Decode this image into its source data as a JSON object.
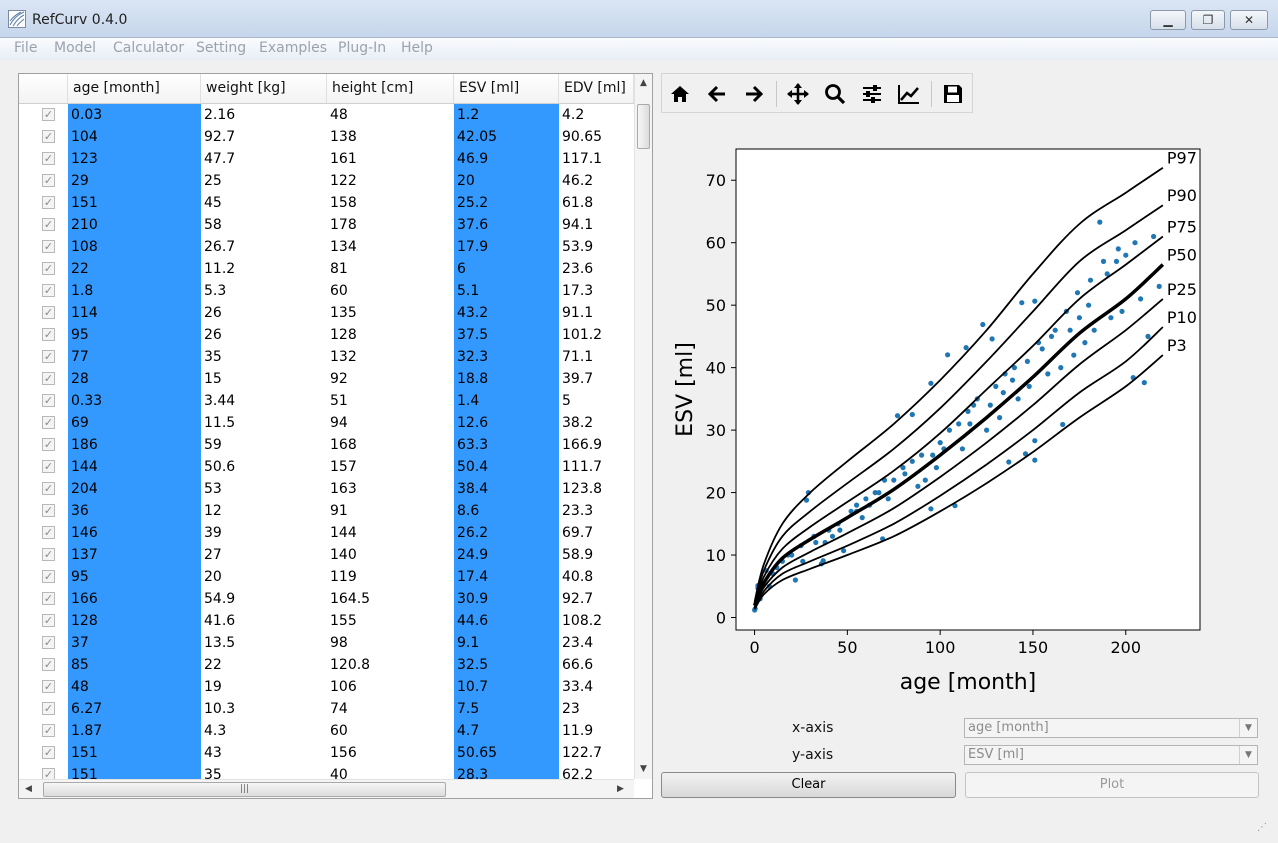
{
  "window": {
    "title": "RefCurv 0.4.0",
    "minimize": "▁",
    "maximize": "❐",
    "close": "✕"
  },
  "menu": [
    "File",
    "Model",
    "Calculator",
    "Setting",
    "Examples",
    "Plug-In",
    "Help"
  ],
  "table": {
    "columns": [
      "age [month]",
      "weight [kg]",
      "height [cm]",
      "ESV [ml]",
      "EDV [ml]"
    ],
    "rows": [
      [
        "0.03",
        "2.16",
        "48",
        "1.2",
        "4.2"
      ],
      [
        "104",
        "92.7",
        "138",
        "42.05",
        "90.65"
      ],
      [
        "123",
        "47.7",
        "161",
        "46.9",
        "117.1"
      ],
      [
        "29",
        "25",
        "122",
        "20",
        "46.2"
      ],
      [
        "151",
        "45",
        "158",
        "25.2",
        "61.8"
      ],
      [
        "210",
        "58",
        "178",
        "37.6",
        "94.1"
      ],
      [
        "108",
        "26.7",
        "134",
        "17.9",
        "53.9"
      ],
      [
        "22",
        "11.2",
        "81",
        "6",
        "23.6"
      ],
      [
        "1.8",
        "5.3",
        "60",
        "5.1",
        "17.3"
      ],
      [
        "114",
        "26",
        "135",
        "43.2",
        "91.1"
      ],
      [
        "95",
        "26",
        "128",
        "37.5",
        "101.2"
      ],
      [
        "77",
        "35",
        "132",
        "32.3",
        "71.1"
      ],
      [
        "28",
        "15",
        "92",
        "18.8",
        "39.7"
      ],
      [
        "0.33",
        "3.44",
        "51",
        "1.4",
        "5"
      ],
      [
        "69",
        "11.5",
        "94",
        "12.6",
        "38.2"
      ],
      [
        "186",
        "59",
        "168",
        "63.3",
        "166.9"
      ],
      [
        "144",
        "50.6",
        "157",
        "50.4",
        "111.7"
      ],
      [
        "204",
        "53",
        "163",
        "38.4",
        "123.8"
      ],
      [
        "36",
        "12",
        "91",
        "8.6",
        "23.3"
      ],
      [
        "146",
        "39",
        "144",
        "26.2",
        "69.7"
      ],
      [
        "137",
        "27",
        "140",
        "24.9",
        "58.9"
      ],
      [
        "95",
        "20",
        "119",
        "17.4",
        "40.8"
      ],
      [
        "166",
        "54.9",
        "164.5",
        "30.9",
        "92.7"
      ],
      [
        "128",
        "41.6",
        "155",
        "44.6",
        "108.2"
      ],
      [
        "37",
        "13.5",
        "98",
        "9.1",
        "23.4"
      ],
      [
        "85",
        "22",
        "120.8",
        "32.5",
        "66.6"
      ],
      [
        "48",
        "19",
        "106",
        "10.7",
        "33.4"
      ],
      [
        "6.27",
        "10.3",
        "74",
        "7.5",
        "23"
      ],
      [
        "1.87",
        "4.3",
        "60",
        "4.7",
        "11.9"
      ],
      [
        "151",
        "43",
        "156",
        "50.65",
        "122.7"
      ],
      [
        "151",
        "35",
        "40",
        "28.3",
        "62.2"
      ]
    ],
    "check_mark": "✓",
    "selected_columns": [
      0,
      3
    ],
    "hscroll_grip": "|||"
  },
  "toolbar": {
    "icons": [
      "home-icon",
      "back-arrow-icon",
      "forward-arrow-icon",
      "pan-icon",
      "zoom-icon",
      "configure-subplots-icon",
      "edit-axis-icon",
      "save-icon"
    ]
  },
  "chart_data": {
    "type": "line",
    "xlabel": "age [month]",
    "ylabel": "ESV [ml]",
    "xlim": [
      -10,
      240
    ],
    "ylim": [
      -2,
      75
    ],
    "xticks": [
      0,
      50,
      100,
      150,
      200
    ],
    "yticks": [
      0,
      10,
      20,
      30,
      40,
      50,
      60,
      70
    ],
    "grid": false,
    "series": [
      {
        "name": "P97",
        "x": [
          0,
          5,
          15,
          30,
          50,
          75,
          100,
          125,
          150,
          175,
          200,
          220
        ],
        "y": [
          2.5,
          8.5,
          15,
          20,
          25,
          31,
          38,
          46,
          55,
          63,
          68,
          72
        ]
      },
      {
        "name": "P90",
        "x": [
          0,
          5,
          15,
          30,
          50,
          75,
          100,
          125,
          150,
          175,
          200,
          220
        ],
        "y": [
          2.3,
          7.5,
          13,
          17,
          21.5,
          27,
          33.5,
          41,
          49,
          57,
          62,
          66
        ]
      },
      {
        "name": "P75",
        "x": [
          0,
          5,
          15,
          30,
          50,
          75,
          100,
          125,
          150,
          175,
          200,
          220
        ],
        "y": [
          2.1,
          6.5,
          11,
          14.5,
          18.5,
          23.5,
          29.5,
          36.5,
          43.5,
          51,
          56.5,
          61
        ]
      },
      {
        "name": "P50",
        "x": [
          0,
          5,
          15,
          30,
          50,
          75,
          100,
          125,
          150,
          175,
          200,
          220
        ],
        "y": [
          1.9,
          5.5,
          9.5,
          12.5,
          16,
          20.5,
          26,
          32,
          38.5,
          45.5,
          51,
          56.5
        ]
      },
      {
        "name": "P25",
        "x": [
          0,
          5,
          15,
          30,
          50,
          75,
          100,
          125,
          150,
          175,
          200,
          220
        ],
        "y": [
          1.7,
          4.8,
          8,
          10.5,
          13.5,
          17.5,
          22.5,
          28,
          34,
          40.5,
          46,
          51
        ]
      },
      {
        "name": "P10",
        "x": [
          0,
          5,
          15,
          30,
          50,
          75,
          100,
          125,
          150,
          175,
          200,
          220
        ],
        "y": [
          1.5,
          4.2,
          7,
          9,
          11.5,
          15,
          19.5,
          24.5,
          30,
          36,
          41,
          46.5
        ]
      },
      {
        "name": "P3",
        "x": [
          0,
          5,
          15,
          30,
          50,
          75,
          100,
          125,
          150,
          175,
          200,
          220
        ],
        "y": [
          1.3,
          3.7,
          6,
          7.8,
          10,
          13,
          17,
          21.5,
          26.5,
          32,
          37,
          42
        ]
      }
    ],
    "bold_series": "P50",
    "scatter": {
      "color": "#1f77b4",
      "x": [
        0.03,
        104,
        123,
        29,
        151,
        210,
        108,
        22,
        1.8,
        114,
        95,
        77,
        28,
        0.33,
        69,
        186,
        144,
        204,
        36,
        146,
        137,
        95,
        166,
        128,
        37,
        85,
        48,
        6.27,
        1.87,
        151,
        151,
        10,
        15,
        20,
        25,
        32,
        40,
        45,
        52,
        55,
        60,
        65,
        70,
        75,
        80,
        85,
        90,
        100,
        105,
        110,
        115,
        118,
        120,
        130,
        135,
        140,
        155,
        160,
        170,
        175,
        180,
        190,
        195,
        200,
        205,
        215,
        12,
        18,
        33,
        42,
        58,
        62,
        72,
        88,
        92,
        98,
        112,
        125,
        132,
        142,
        148,
        158,
        165,
        172,
        178,
        183,
        192,
        198,
        208,
        218,
        3,
        8,
        26,
        38,
        46,
        55,
        67,
        81,
        96,
        102,
        116,
        127,
        134,
        139,
        147,
        153,
        162,
        168,
        174,
        181,
        188,
        196,
        212
      ],
      "y": [
        1.2,
        42.05,
        46.9,
        20,
        25.2,
        37.6,
        17.9,
        6,
        5.1,
        43.2,
        37.5,
        32.3,
        18.8,
        1.4,
        12.6,
        63.3,
        50.4,
        38.4,
        8.6,
        26.2,
        24.9,
        17.4,
        30.9,
        44.6,
        9.1,
        32.5,
        10.7,
        7.5,
        4.7,
        50.65,
        28.3,
        7,
        9,
        10,
        11.5,
        13,
        14,
        15,
        17,
        18,
        19,
        20,
        22,
        22,
        24,
        25,
        26,
        28,
        30,
        31,
        33,
        34,
        35,
        37,
        39,
        40,
        43,
        45,
        46,
        48,
        50,
        55,
        57,
        58,
        60,
        61,
        8,
        10,
        12,
        13,
        16,
        18,
        19,
        21,
        22,
        24,
        27,
        30,
        32,
        35,
        37,
        39,
        40,
        42,
        44,
        46,
        48,
        49,
        51,
        53,
        3,
        5,
        9,
        12,
        14,
        17,
        20,
        23,
        26,
        27,
        31,
        34,
        36,
        38,
        41,
        44,
        46,
        49,
        52,
        54,
        57,
        59,
        45
      ]
    }
  },
  "controls": {
    "x_label": "x-axis",
    "y_label": "y-axis",
    "x_value": "age [month]",
    "y_value": "ESV [ml]",
    "clear_label": "Clear",
    "plot_label": "Plot",
    "dropdown_glyph": "▼"
  }
}
